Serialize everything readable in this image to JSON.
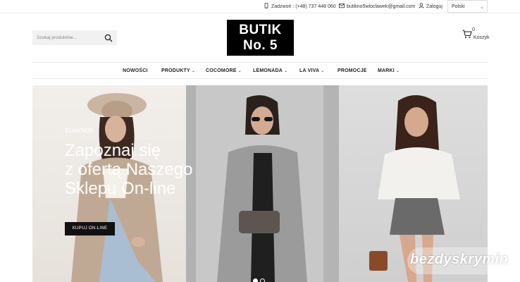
{
  "topbar": {
    "phone_label": "Zadzwoń : (+48) 737 448 060",
    "email_label": "butikno5wloclawek@gmail.com",
    "login_label": "Zaloguj",
    "language_selected": "Polski"
  },
  "header": {
    "search_placeholder": "Szukaj produktów...",
    "logo_line1": "BUTIK",
    "logo_line2": "No. 5",
    "cart_count": "0",
    "cart_label": "Koszyk"
  },
  "nav": {
    "items": [
      {
        "label": "NOWOŚCI",
        "dropdown": false
      },
      {
        "label": "PRODUKTY",
        "dropdown": true
      },
      {
        "label": "COCOMORE",
        "dropdown": true
      },
      {
        "label": "LEMONADA",
        "dropdown": true
      },
      {
        "label": "LA VIVA",
        "dropdown": true
      },
      {
        "label": "PROMOCJE",
        "dropdown": false
      },
      {
        "label": "MARKI",
        "dropdown": true
      }
    ]
  },
  "hero": {
    "tag": "ButikNo5",
    "title_lines": [
      "Zapoznaj się",
      "z ofertą Naszego",
      "Sklepu On-line"
    ],
    "button_label": "KUPUJ ON-LINE",
    "slides_total": 2,
    "slide_active": 1
  },
  "watermark": "bezdyskrymin",
  "colors": {
    "logo_bg": "#000000",
    "button_bg": "#111111",
    "search_bg": "#f1f1f1"
  }
}
